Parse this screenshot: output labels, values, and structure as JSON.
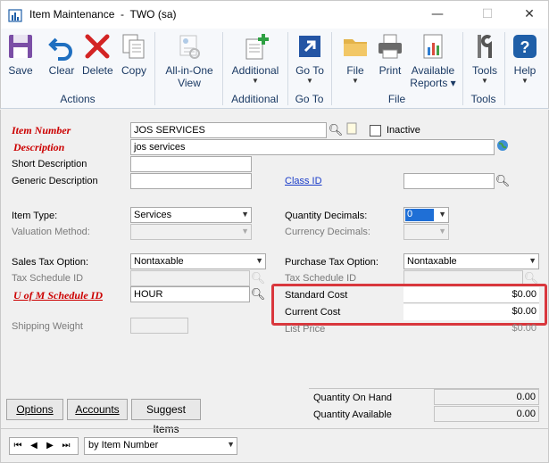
{
  "window": {
    "title": "Item Maintenance  -  TWO (sa)",
    "minimize": "—",
    "maximize": "☐",
    "close": "✕"
  },
  "ribbon": {
    "buttons": {
      "save": "Save",
      "clear": "Clear",
      "delete": "Delete",
      "copy": "Copy",
      "all_in_one_line1": "All-in-One",
      "all_in_one_line2": "View",
      "additional": "Additional",
      "goto": "Go To",
      "file": "File",
      "print": "Print",
      "available_line1": "Available",
      "available_line2": "Reports",
      "tools": "Tools",
      "help": "Help"
    },
    "groups": {
      "actions": "Actions",
      "additional": "Additional",
      "goto": "Go To",
      "file": "File",
      "tools": "Tools"
    }
  },
  "form": {
    "item_number_label": "Item Number",
    "item_number_value": "JOS SERVICES",
    "inactive_label": "Inactive",
    "description_label": "Description",
    "description_value": "jos services",
    "short_description_label": "Short Description",
    "short_description_value": "",
    "generic_description_label": "Generic Description",
    "generic_description_value": "",
    "class_id_label": "Class ID",
    "class_id_value": "",
    "item_type_label": "Item Type:",
    "item_type_value": "Services",
    "valuation_method_label": "Valuation Method:",
    "valuation_method_value": "",
    "quantity_decimals_label": "Quantity Decimals:",
    "quantity_decimals_value": "0",
    "currency_decimals_label": "Currency Decimals:",
    "currency_decimals_value": "",
    "sales_tax_option_label": "Sales Tax Option:",
    "sales_tax_option_value": "Nontaxable",
    "purchase_tax_option_label": "Purchase Tax Option:",
    "purchase_tax_option_value": "Nontaxable",
    "sales_tax_schedule_label": "Tax Schedule ID",
    "purchase_tax_schedule_label": "Tax Schedule ID",
    "uofm_schedule_label": "U of M Schedule ID",
    "uofm_schedule_value": "HOUR",
    "standard_cost_label": "Standard Cost",
    "standard_cost_value": "$0.00",
    "current_cost_label": "Current Cost",
    "current_cost_value": "$0.00",
    "list_price_label": "List Price",
    "list_price_value": "$0.00",
    "shipping_weight_label": "Shipping Weight",
    "shipping_weight_value": "",
    "quantity_on_hand_label": "Quantity On Hand",
    "quantity_on_hand_value": "0.00",
    "quantity_available_label": "Quantity Available",
    "quantity_available_value": "0.00"
  },
  "footer": {
    "options": "Options",
    "accounts": "Accounts",
    "suggest_items": "Suggest Items",
    "sort_by": "by Item Number",
    "nav_first": "⏮",
    "nav_prev": "◀",
    "nav_next": "▶",
    "nav_last": "⏭"
  },
  "colors": {
    "required_label": "#cc0000",
    "link_label": "#1a3cc9",
    "highlight_border": "#d9373d",
    "ribbon_text": "#1b3a64"
  }
}
